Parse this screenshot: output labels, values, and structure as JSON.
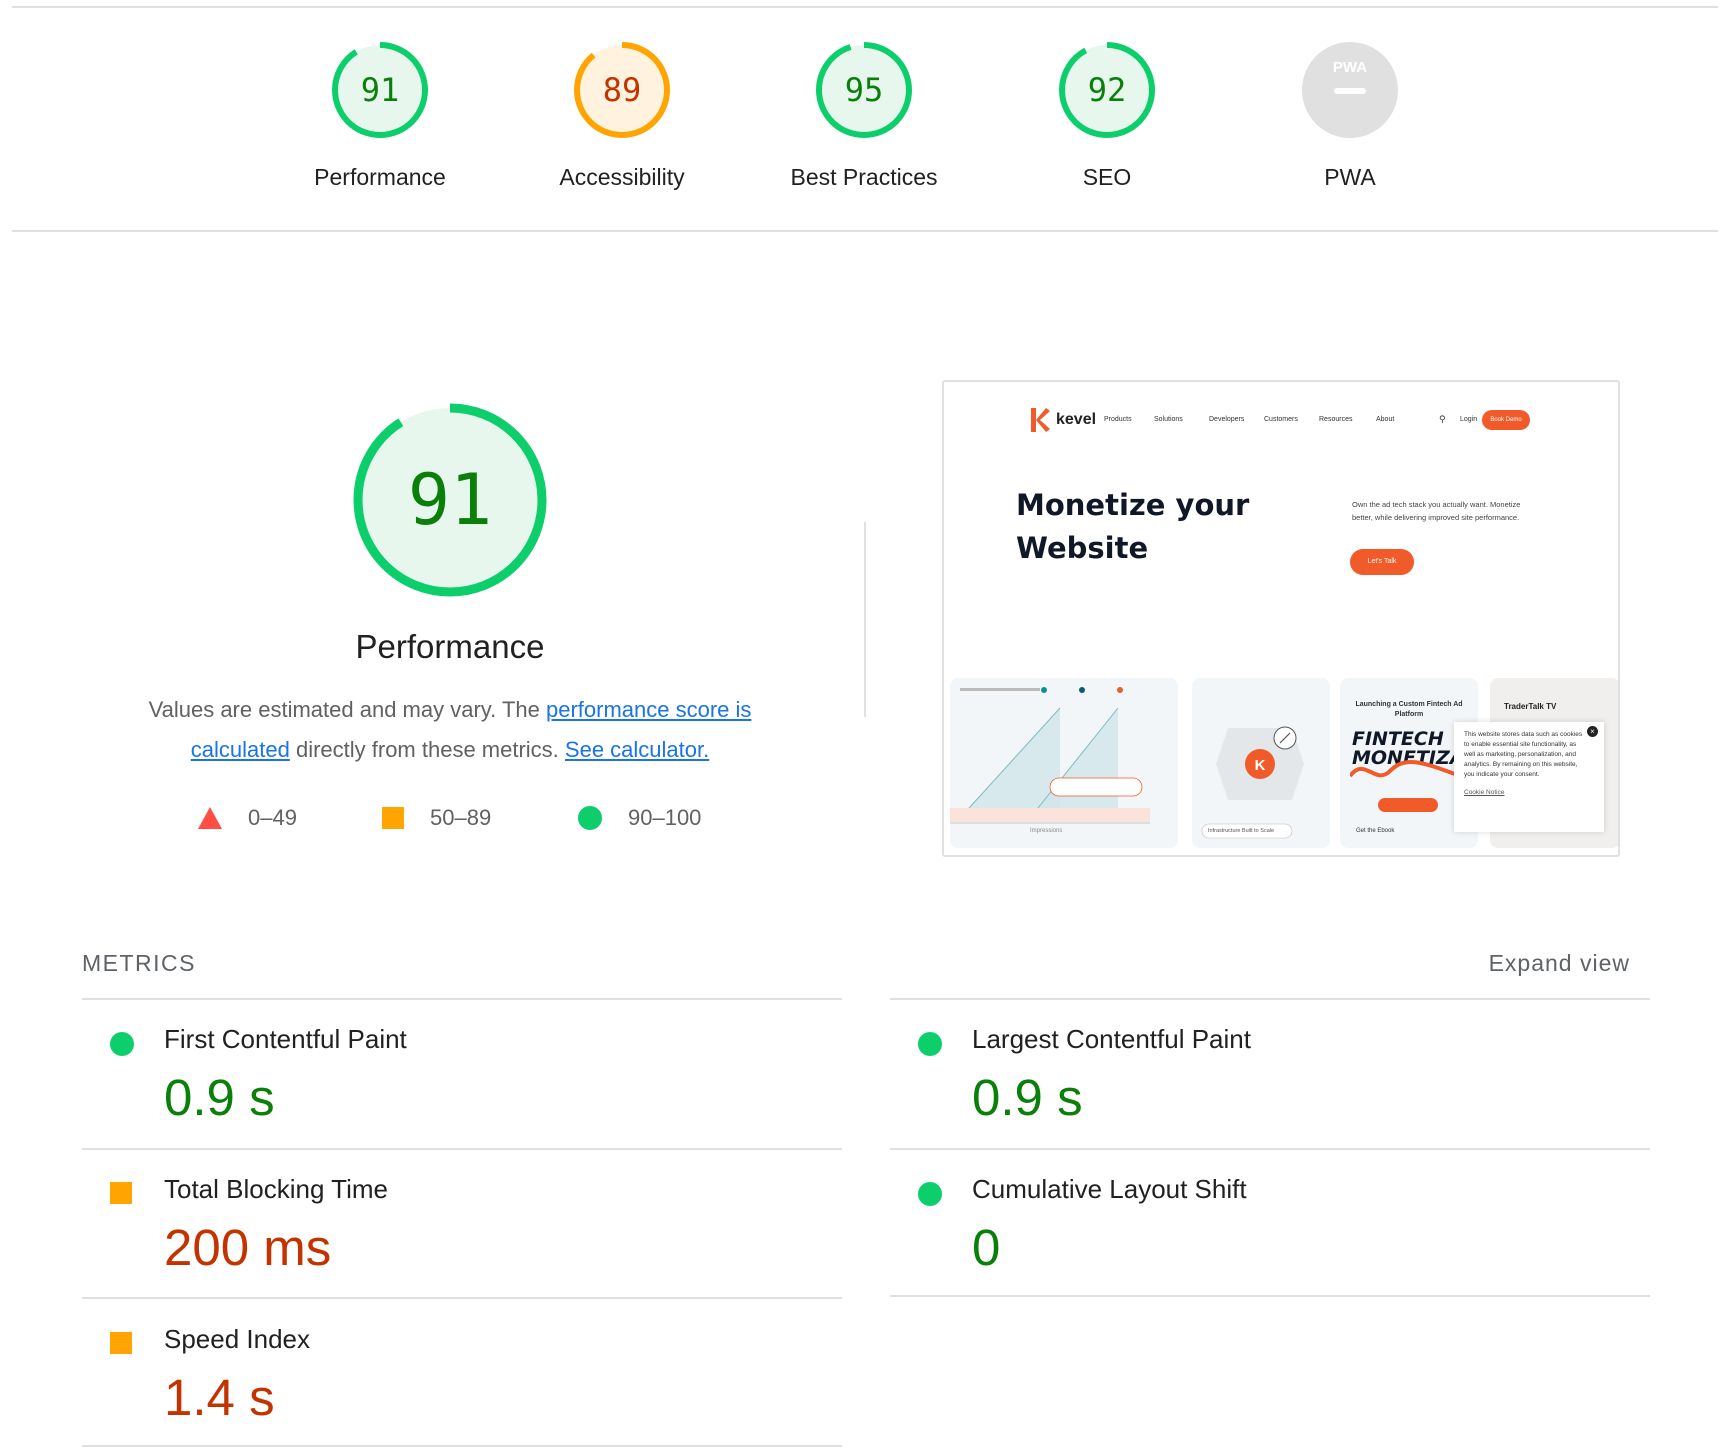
{
  "gauges": [
    {
      "score": "91",
      "label": "Performance",
      "value": 91,
      "status": "pass"
    },
    {
      "score": "89",
      "label": "Accessibility",
      "value": 89,
      "status": "average"
    },
    {
      "score": "95",
      "label": "Best Practices",
      "value": 95,
      "status": "pass"
    },
    {
      "score": "92",
      "label": "SEO",
      "value": 92,
      "status": "pass"
    },
    {
      "score": "",
      "label": "PWA",
      "badge": "PWA",
      "status": "na"
    }
  ],
  "colors": {
    "pass": "#0cce6b",
    "pass_text": "#0a7f0a",
    "pass_bg": "#e8f7ee",
    "average": "#ffa400",
    "average_text": "#c33300",
    "average_bg": "#fff3e0",
    "fail": "#ff4e42",
    "na": "#e0e0e0",
    "link": "#1a73e8",
    "brand": "#f15a29"
  },
  "performance": {
    "score": "91",
    "value": 91,
    "title": "Performance",
    "desc_prefix": "Values are estimated and may vary. The ",
    "link1": "performance score is calculated",
    "desc_mid": " directly from these metrics. ",
    "link2": "See calculator."
  },
  "legend": [
    {
      "shape": "triangle",
      "range": "0–49"
    },
    {
      "shape": "square",
      "range": "50–89"
    },
    {
      "shape": "circle",
      "range": "90–100"
    }
  ],
  "screenshot": {
    "brand": "kevel",
    "nav": [
      "Products",
      "Solutions",
      "Developers",
      "Customers",
      "Resources",
      "About",
      "Login"
    ],
    "nav_cta": "Book Demo",
    "headline_1": "Monetize your",
    "headline_2": "Website",
    "subtext": "Own the ad tech stack you actually want. Monetize better, while delivering improved site performance.",
    "cta": "Let's Talk",
    "card1_footer": "Impressions",
    "card2_footer": "Infrastructure Built to Scale",
    "card3_title": "Launching a Custom Fintech Ad Platform",
    "card3_big": "FINTECH MONETIZATION",
    "card3_footer": "Get the Ebook",
    "card4_title": "TraderTalk TV",
    "cookie_text": "This website stores data such as cookies to enable essential site functionality, as well as marketing, personalization, and analytics. By remaining on this website, you indicate your consent.",
    "cookie_link": "Cookie Notice"
  },
  "metrics": {
    "header": "METRICS",
    "expand": "Expand view",
    "left": [
      {
        "name": "First Contentful Paint",
        "value": "0.9 s",
        "status": "pass"
      },
      {
        "name": "Total Blocking Time",
        "value": "200 ms",
        "status": "average"
      },
      {
        "name": "Speed Index",
        "value": "1.4 s",
        "status": "average"
      }
    ],
    "right": [
      {
        "name": "Largest Contentful Paint",
        "value": "0.9 s",
        "status": "pass"
      },
      {
        "name": "Cumulative Layout Shift",
        "value": "0",
        "status": "pass"
      }
    ]
  }
}
